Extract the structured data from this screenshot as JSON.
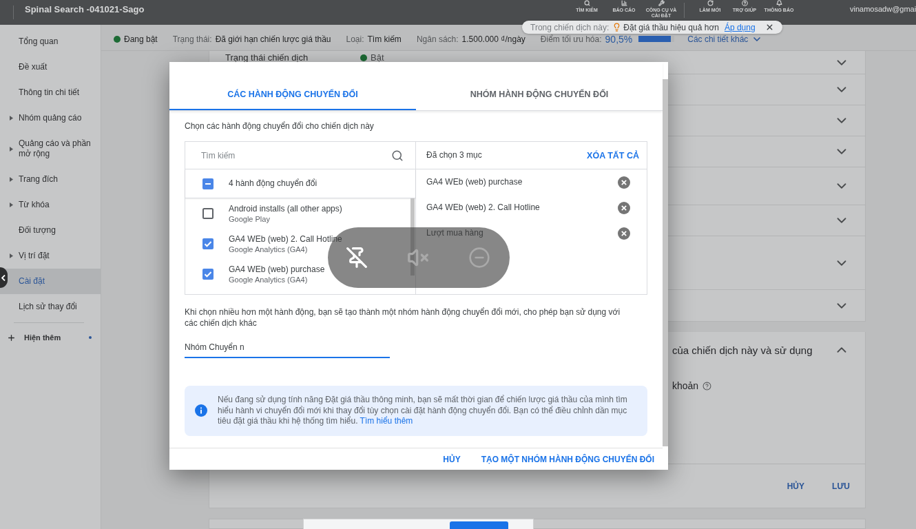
{
  "top_bar": {
    "account_title": "Spinal Search -041021-Sago",
    "tools": [
      {
        "label": "TÌM KIẾM"
      },
      {
        "label": "BÁO CÁO"
      },
      {
        "label": "CÔNG CỤ VÀ CÀI ĐẶT"
      }
    ],
    "actions": [
      {
        "label": "LÀM MỚI"
      },
      {
        "label": "TRỢ GIÚP"
      },
      {
        "label": "THÔNG BÁO"
      }
    ],
    "user_email": "vinamosadw@gmai"
  },
  "notification_chip": {
    "prefix": "Trong chiến dịch này:",
    "message": "Đặt giá thầu hiệu quả hơn",
    "action": "Áp dụng"
  },
  "sidebar": {
    "items": [
      {
        "label": "Tổng quan",
        "expandable": false,
        "selected": false
      },
      {
        "label": "Đề xuất",
        "expandable": false,
        "selected": false
      },
      {
        "label": "Thông tin chi tiết",
        "expandable": false,
        "selected": false
      },
      {
        "label": "Nhóm quảng cáo",
        "expandable": true,
        "selected": false
      },
      {
        "label": "Quảng cáo và phần mở rộng",
        "expandable": true,
        "selected": false
      },
      {
        "label": "Trang đích",
        "expandable": true,
        "selected": false
      },
      {
        "label": "Từ khóa",
        "expandable": true,
        "selected": false
      },
      {
        "label": "Đối tượng",
        "expandable": false,
        "selected": false
      },
      {
        "label": "Vị trí đặt",
        "expandable": true,
        "selected": false
      },
      {
        "label": "Cài đặt",
        "expandable": false,
        "selected": true
      },
      {
        "label": "Lịch sử thay đổi",
        "expandable": false,
        "selected": false
      }
    ],
    "more": {
      "label": "Hiện thêm",
      "has_update": true
    }
  },
  "status_bar": {
    "status": "Đang bật",
    "fields": [
      {
        "label": "Trạng thái:",
        "value": "Đã giới hạn chiến lược giá thầu"
      },
      {
        "label": "Loại:",
        "value": "Tìm kiếm"
      },
      {
        "label": "Ngân sách:",
        "value": "1.500.000 ₫/ngày"
      }
    ],
    "optimization": {
      "label": "Điểm tối ưu hóa:",
      "value": "90,5%",
      "level": 0.905
    },
    "details_link": "Các chi tiết khác"
  },
  "settings": {
    "rows": [
      {
        "label": "Trạng thái chiến dịch",
        "value": "Bật",
        "expanded": false
      },
      {
        "expanded": false
      },
      {
        "expanded": false
      },
      {
        "expanded": false
      },
      {
        "expanded": false
      },
      {
        "expanded": false
      },
      {
        "expanded": false
      },
      {
        "expanded": false
      }
    ]
  },
  "goals_section": {
    "title": "của chiến dịch này và sử dụng",
    "expanded": true,
    "field_label": "khoản",
    "buttons": [
      {
        "label": "HỦY"
      },
      {
        "label": "LƯU"
      }
    ]
  },
  "dialog": {
    "tabs": [
      {
        "label": "CÁC HÀNH ĐỘNG CHUYỂN ĐỔI",
        "selected": true
      },
      {
        "label": "NHÓM HÀNH ĐỘNG CHUYỂN ĐỔI",
        "selected": false
      }
    ],
    "instruction": "Chọn các hành động chuyển đổi cho chiến dịch này",
    "search": {
      "placeholder": "Tìm kiếm"
    },
    "select_all": {
      "label": "4 hành động chuyển đổi",
      "indeterminate": true
    },
    "actions": [
      {
        "name": "Android installs (all other apps)",
        "source": "Google Play",
        "checked": false
      },
      {
        "name": "GA4 WEb (web) 2. Call Hotline",
        "source": "Google Analytics (GA4)",
        "checked": true
      },
      {
        "name": "GA4 WEb (web) purchase",
        "source": "Google Analytics (GA4)",
        "checked": true
      }
    ],
    "selected_summary": "Đã chọn 3 mục",
    "clear_all": "XÓA TẤT CẢ",
    "chosen_items": [
      "GA4 WEb (web) purchase",
      "GA4 WEb (web) 2. Call Hotline",
      "Lượt mua hàng"
    ],
    "note": "Khi chọn nhiều hơn một hành động, bạn sẽ tạo thành một nhóm hành động chuyển đổi mới, cho phép bạn sử dụng với các chiến dịch khác",
    "group_name": {
      "value": "Nhóm Chuyển n"
    },
    "info": {
      "text": "Nếu đang sử dụng tính năng Đặt giá thầu thông minh, bạn sẽ mất thời gian để chiến lược giá thầu của mình tìm hiểu hành vi chuyển đổi mới khi thay đổi tùy chọn cài đặt hành động chuyển đổi. Bạn có thể điều chỉnh dần mục tiêu đặt giá thầu khi hệ thống tìm hiểu.",
      "link": "Tìm hiểu thêm"
    },
    "buttons": [
      {
        "label": "HỦY"
      },
      {
        "label": "TẠO MỘT NHÓM HÀNH ĐỘNG CHUYỂN ĐỔI"
      }
    ]
  }
}
